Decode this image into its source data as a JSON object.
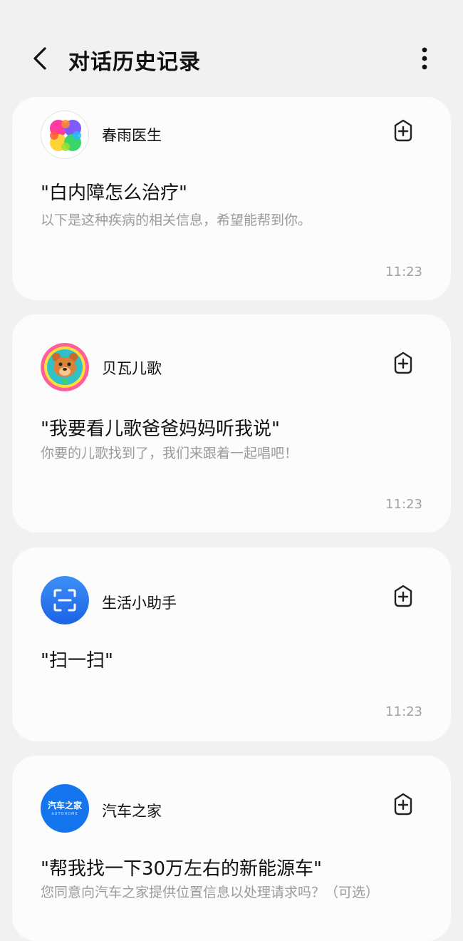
{
  "header": {
    "title": "对话历史记录",
    "back_icon": "chevron-left-icon",
    "more_icon": "more-vertical-icon"
  },
  "conversations": [
    {
      "app_name": "春雨医生",
      "avatar_icon": "chunyu-doctor-logo",
      "query": "\"白内障怎么治疗\"",
      "reply": "以下是这种疾病的相关信息，希望能帮到你。",
      "time": "11:23"
    },
    {
      "app_name": "贝瓦儿歌",
      "avatar_icon": "beiwa-bear-logo",
      "query": "\"我要看儿歌爸爸妈妈听我说\"",
      "reply": "你要的儿歌找到了，我们来跟着一起唱吧！",
      "time": "11:23"
    },
    {
      "app_name": "生活小助手",
      "avatar_icon": "scan-logo",
      "query": "\"扫一扫\"",
      "reply": "",
      "time": "11:23"
    },
    {
      "app_name": "汽车之家",
      "avatar_icon": "autohome-logo",
      "logo_text": "汽车之家",
      "logo_subtext": "AUTOHOME",
      "query": "\"帮我找一下30万左右的新能源车\"",
      "reply": "您同意向汽车之家提供位置信息以处理请求吗？（可选）",
      "time": ""
    }
  ],
  "add_icon": "add-shortcut-icon",
  "colors": {
    "background": "#f1f1f1",
    "card": "#fcfcfc",
    "secondary_text": "#9b9b9b",
    "autohome_blue": "#1475ee",
    "scan_blue": "#2e7df0"
  }
}
